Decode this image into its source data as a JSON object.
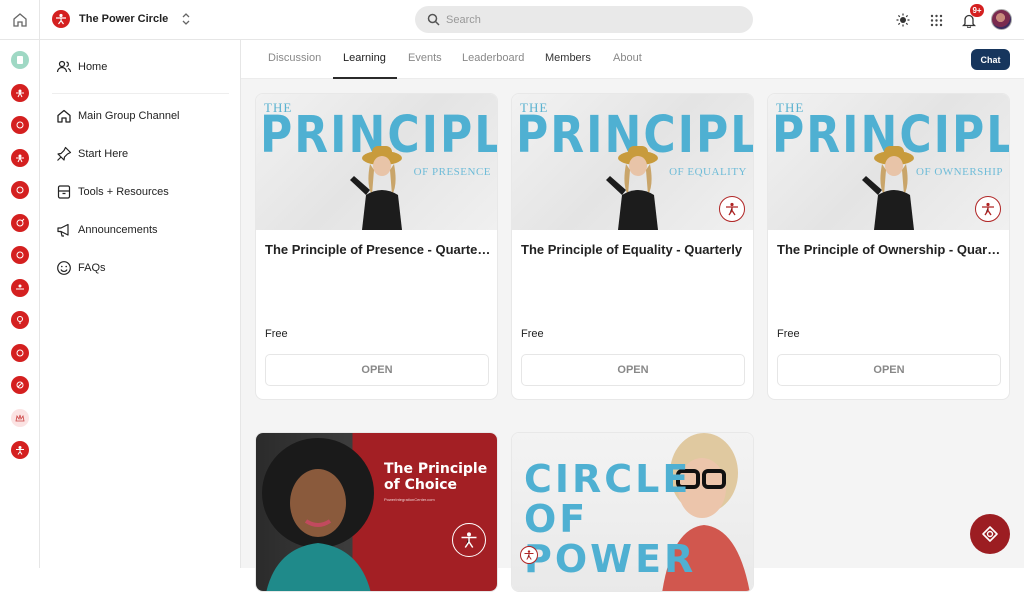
{
  "colors": {
    "brand_red": "#d42020",
    "accent_blue": "#4fb0d2",
    "chat_navy": "#17365d",
    "fab_red": "#9c1d22"
  },
  "header": {
    "community_name": "The Power Circle",
    "search_placeholder": "Search",
    "notification_badge": "9+",
    "icons": [
      "sun-icon",
      "apps-grid-icon",
      "bell-icon",
      "avatar"
    ]
  },
  "rail": {
    "icons": [
      "home-icon",
      "community-green-icon",
      "community-red-icon"
    ]
  },
  "sidebar": {
    "items": [
      {
        "label": "Home",
        "icon": "people-icon"
      },
      {
        "label": "Main Group Channel",
        "icon": "house-icon"
      },
      {
        "label": "Start Here",
        "icon": "pin-icon"
      },
      {
        "label": "Tools + Resources",
        "icon": "box-icon"
      },
      {
        "label": "Announcements",
        "icon": "megaphone-icon"
      },
      {
        "label": "FAQs",
        "icon": "smiley-icon"
      }
    ]
  },
  "tabs": [
    {
      "label": "Discussion",
      "active": false
    },
    {
      "label": "Learning",
      "active": true
    },
    {
      "label": "Events",
      "active": false
    },
    {
      "label": "Leaderboard",
      "active": false
    },
    {
      "label": "Members",
      "active": false
    },
    {
      "label": "About",
      "active": false
    }
  ],
  "chat_button": "Chat",
  "courses": [
    {
      "image_top": "THE",
      "image_big": "PRINCIPLE",
      "image_sub": "OF PRESENCE",
      "title": "The Principle of Presence - Quarterly",
      "price": "Free",
      "action": "OPEN"
    },
    {
      "image_top": "THE",
      "image_big": "PRINCIPLE",
      "image_sub": "OF EQUALITY",
      "title": "The Principle of Equality - Quarterly",
      "price": "Free",
      "action": "OPEN"
    },
    {
      "image_top": "THE",
      "image_big": "PRINCIPLE",
      "image_sub": "OF OWNERSHIP",
      "title": "The Principle of Ownership - Quarterly",
      "price": "Free",
      "action": "OPEN"
    },
    {
      "image_title": "The Principle of Choice",
      "image_url_text": "PowerIntegrationCenter.com"
    },
    {
      "image_big": "CIRCLE OF POWER"
    }
  ]
}
